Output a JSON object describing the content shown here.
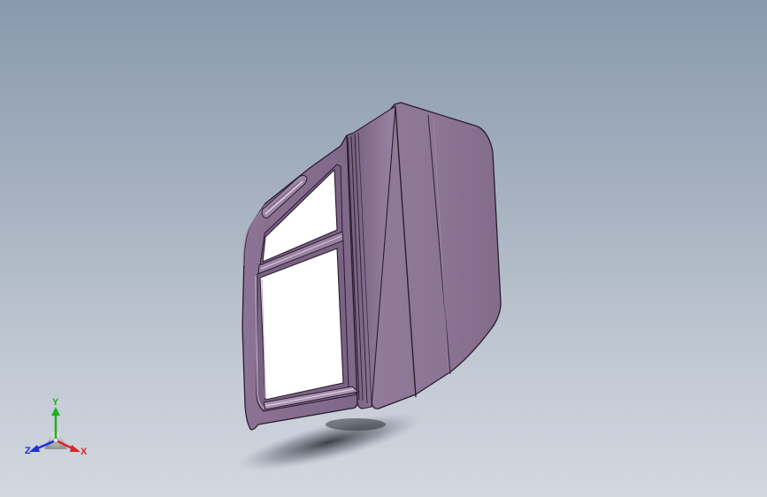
{
  "viewport": {
    "background_top": "#8999ad",
    "background_bottom": "#d3d8df"
  },
  "model": {
    "part_color": "#8a7293",
    "part_color_light": "#9d86a5",
    "part_color_dark": "#735c7d",
    "edge_color": "#2a1d2e",
    "window_color": "#ffffff"
  },
  "triad": {
    "y_label": "Y",
    "z_label": "Z",
    "x_label": "X",
    "y_color": "#1db31d",
    "z_color": "#1f2fd6",
    "x_color": "#d62828"
  }
}
